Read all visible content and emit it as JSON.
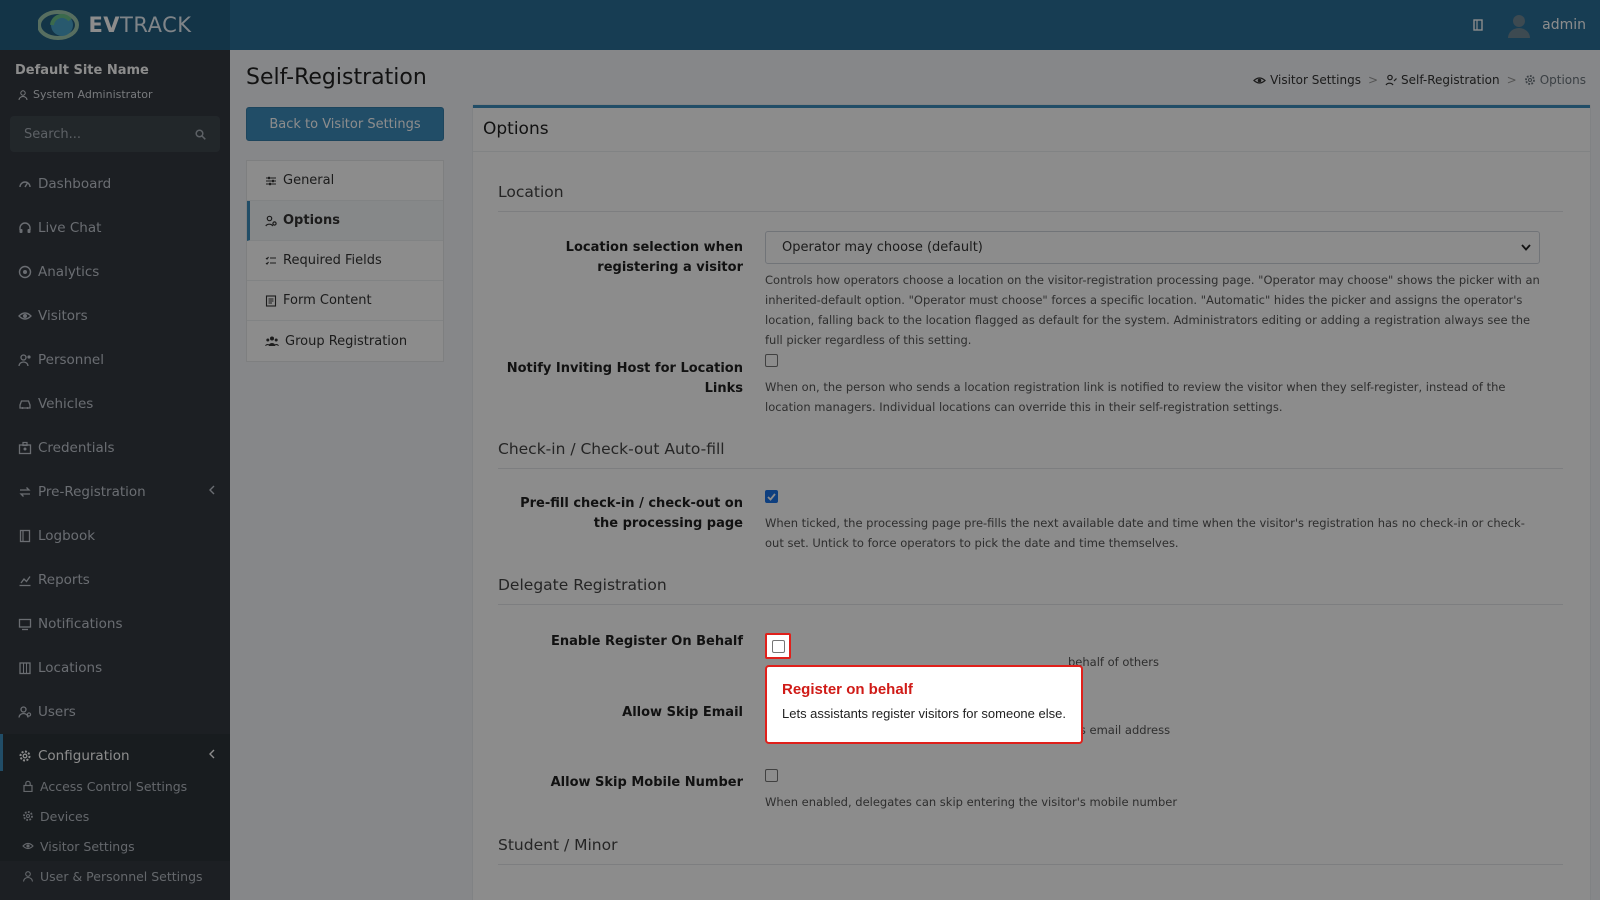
{
  "topbar": {
    "brand_bold": "EV",
    "brand_rest": "TRACK",
    "user_name": "admin"
  },
  "sidebar": {
    "site_name": "Default Site Name",
    "role": "System Administrator",
    "search_placeholder": "Search...",
    "items": [
      {
        "label": "Dashboard",
        "icon": "dashboard-icon"
      },
      {
        "label": "Live Chat",
        "icon": "headset-icon"
      },
      {
        "label": "Analytics",
        "icon": "target-icon"
      },
      {
        "label": "Visitors",
        "icon": "eye-icon"
      },
      {
        "label": "Personnel",
        "icon": "user-gear-icon"
      },
      {
        "label": "Vehicles",
        "icon": "car-icon"
      },
      {
        "label": "Credentials",
        "icon": "id-card-icon"
      },
      {
        "label": "Pre-Registration",
        "icon": "arrows-icon"
      },
      {
        "label": "Logbook",
        "icon": "book-icon"
      },
      {
        "label": "Reports",
        "icon": "chart-icon"
      },
      {
        "label": "Notifications",
        "icon": "bell-icon"
      },
      {
        "label": "Locations",
        "icon": "building-icon"
      },
      {
        "label": "Users",
        "icon": "users-icon"
      },
      {
        "label": "Configuration",
        "icon": "gear-icon"
      }
    ],
    "sub_items": [
      {
        "label": "Access Control Settings",
        "icon": "lock-icon"
      },
      {
        "label": "Devices",
        "icon": "gear-icon"
      },
      {
        "label": "Visitor Settings",
        "icon": "eye-icon"
      },
      {
        "label": "User & Personnel Settings",
        "icon": "user-icon"
      }
    ]
  },
  "page": {
    "title": "Self-Registration",
    "back_button": "Back to Visitor Settings",
    "breadcrumb": [
      "Visitor Settings",
      "Self-Registration",
      "Options"
    ],
    "breadcrumb_sep": ">",
    "tabs": [
      "General",
      "Options",
      "Required Fields",
      "Form Content",
      "Group Registration"
    ],
    "active_tab": "Options"
  },
  "card": {
    "title": "Options",
    "sections": {
      "location": "Location",
      "checkin": "Check-in / Check-out Auto-fill",
      "delegate": "Delegate Registration",
      "student": "Student / Minor"
    },
    "fields": {
      "location_selection": {
        "label": "Location selection when registering a visitor",
        "value": "Operator may choose (default)",
        "help": "Controls how operators choose a location on the visitor-registration processing page. \"Operator may choose\" shows the picker with an inherited-default option. \"Operator must choose\" forces a specific location. \"Automatic\" hides the picker and assigns the operator's location, falling back to the location flagged as default for the system. Administrators editing or adding a registration always see the full picker regardless of this setting."
      },
      "notify_host": {
        "label": "Notify Inviting Host for Location Links",
        "checked": false,
        "help": "When on, the person who sends a location registration link is notified to review the visitor when they self-register, instead of the location managers. Individual locations can override this in their self-registration settings."
      },
      "prefill": {
        "label": "Pre-fill check-in / check-out on the processing page",
        "checked": true,
        "help": "When ticked, the processing page pre-fills the next available date and time when the visitor's registration has no check-in or check-out set. Untick to force operators to pick the date and time themselves."
      },
      "register_on_behalf": {
        "label": "Enable Register On Behalf",
        "checked": false,
        "help_visible": "behalf of others"
      },
      "skip_email": {
        "label": "Allow Skip Email",
        "checked": false,
        "help": "When enabled, delegates can skip entering the visitor's email address"
      },
      "skip_mobile": {
        "label": "Allow Skip Mobile Number",
        "checked": false,
        "help": "When enabled, delegates can skip entering the visitor's mobile number"
      }
    }
  },
  "tooltip": {
    "title": "Register on behalf",
    "body": "Lets assistants register visitors for someone else."
  },
  "colors": {
    "topbar": "#2a6f97",
    "sidebar": "#343a40",
    "accent": "#3c8dbc",
    "callout": "#e0201b"
  }
}
